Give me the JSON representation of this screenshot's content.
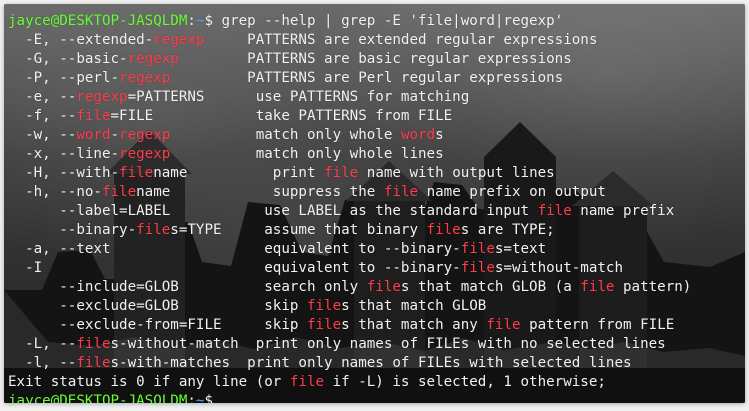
{
  "terminal": {
    "lines": [
      [
        {
          "text": "jayce@DESKTOP-JASQLDM",
          "cls": "prompt-user"
        },
        {
          "text": ":",
          "cls": "prompt-sep"
        },
        {
          "text": "~",
          "cls": "prompt-path"
        },
        {
          "text": "$ grep --help | grep -E 'file|word|regexp'",
          "cls": "prompt-dollar"
        }
      ],
      [
        {
          "text": "  -E, --extended-"
        },
        {
          "text": "regexp",
          "cls": "hl"
        },
        {
          "text": "     PATTERNS are extended regular expressions"
        }
      ],
      [
        {
          "text": "  -G, --basic-"
        },
        {
          "text": "regexp",
          "cls": "hl"
        },
        {
          "text": "        PATTERNS are basic regular expressions"
        }
      ],
      [
        {
          "text": "  -P, --perl-"
        },
        {
          "text": "regexp",
          "cls": "hl"
        },
        {
          "text": "         PATTERNS are Perl regular expressions"
        }
      ],
      [
        {
          "text": "  -e, --"
        },
        {
          "text": "regexp",
          "cls": "hl"
        },
        {
          "text": "=PATTERNS      use PATTERNS for matching"
        }
      ],
      [
        {
          "text": "  -f, --"
        },
        {
          "text": "file",
          "cls": "hl"
        },
        {
          "text": "=FILE            take PATTERNS from FILE"
        }
      ],
      [
        {
          "text": "  -w, --"
        },
        {
          "text": "word",
          "cls": "hl"
        },
        {
          "text": "-"
        },
        {
          "text": "regexp",
          "cls": "hl"
        },
        {
          "text": "          match only whole "
        },
        {
          "text": "word",
          "cls": "hl"
        },
        {
          "text": "s"
        }
      ],
      [
        {
          "text": "  -x, --line-"
        },
        {
          "text": "regexp",
          "cls": "hl"
        },
        {
          "text": "          match only whole lines"
        }
      ],
      [
        {
          "text": "  -H, --with-"
        },
        {
          "text": "file",
          "cls": "hl"
        },
        {
          "text": "name          print "
        },
        {
          "text": "file",
          "cls": "hl"
        },
        {
          "text": " name with output lines"
        }
      ],
      [
        {
          "text": "  -h, --no-"
        },
        {
          "text": "file",
          "cls": "hl"
        },
        {
          "text": "name            suppress the "
        },
        {
          "text": "file",
          "cls": "hl"
        },
        {
          "text": " name prefix on output"
        }
      ],
      [
        {
          "text": "      --label=LABEL           use LABEL as the standard input "
        },
        {
          "text": "file",
          "cls": "hl"
        },
        {
          "text": " name prefix"
        }
      ],
      [
        {
          "text": "      --binary-"
        },
        {
          "text": "file",
          "cls": "hl"
        },
        {
          "text": "s=TYPE     assume that binary "
        },
        {
          "text": "file",
          "cls": "hl"
        },
        {
          "text": "s are TYPE;"
        }
      ],
      [
        {
          "text": "  -a, --text                  equivalent to --binary-"
        },
        {
          "text": "file",
          "cls": "hl"
        },
        {
          "text": "s=text"
        }
      ],
      [
        {
          "text": "  -I                          equivalent to --binary-"
        },
        {
          "text": "file",
          "cls": "hl"
        },
        {
          "text": "s=without-match"
        }
      ],
      [
        {
          "text": "      --include=GLOB          search only "
        },
        {
          "text": "file",
          "cls": "hl"
        },
        {
          "text": "s that match GLOB (a "
        },
        {
          "text": "file",
          "cls": "hl"
        },
        {
          "text": " pattern)"
        }
      ],
      [
        {
          "text": "      --exclude=GLOB          skip "
        },
        {
          "text": "file",
          "cls": "hl"
        },
        {
          "text": "s that match GLOB"
        }
      ],
      [
        {
          "text": "      --exclude-from=FILE     skip "
        },
        {
          "text": "file",
          "cls": "hl"
        },
        {
          "text": "s that match any "
        },
        {
          "text": "file",
          "cls": "hl"
        },
        {
          "text": " pattern from FILE"
        }
      ],
      [
        {
          "text": "  -L, --"
        },
        {
          "text": "file",
          "cls": "hl"
        },
        {
          "text": "s-without-match  print only names of FILEs with no selected lines"
        }
      ],
      [
        {
          "text": "  -l, --"
        },
        {
          "text": "file",
          "cls": "hl"
        },
        {
          "text": "s-with-matches  print only names of FILEs with selected lines"
        }
      ],
      [
        {
          "text": "Exit status is 0 if any line (or "
        },
        {
          "text": "file",
          "cls": "hl"
        },
        {
          "text": " if -L) is selected, 1 otherwise;"
        }
      ],
      [
        {
          "text": "jayce@DESKTOP-JASQLDM",
          "cls": "prompt-user"
        },
        {
          "text": ":",
          "cls": "prompt-sep"
        },
        {
          "text": "~",
          "cls": "prompt-path"
        },
        {
          "text": "$",
          "cls": "prompt-dollar"
        }
      ]
    ]
  }
}
